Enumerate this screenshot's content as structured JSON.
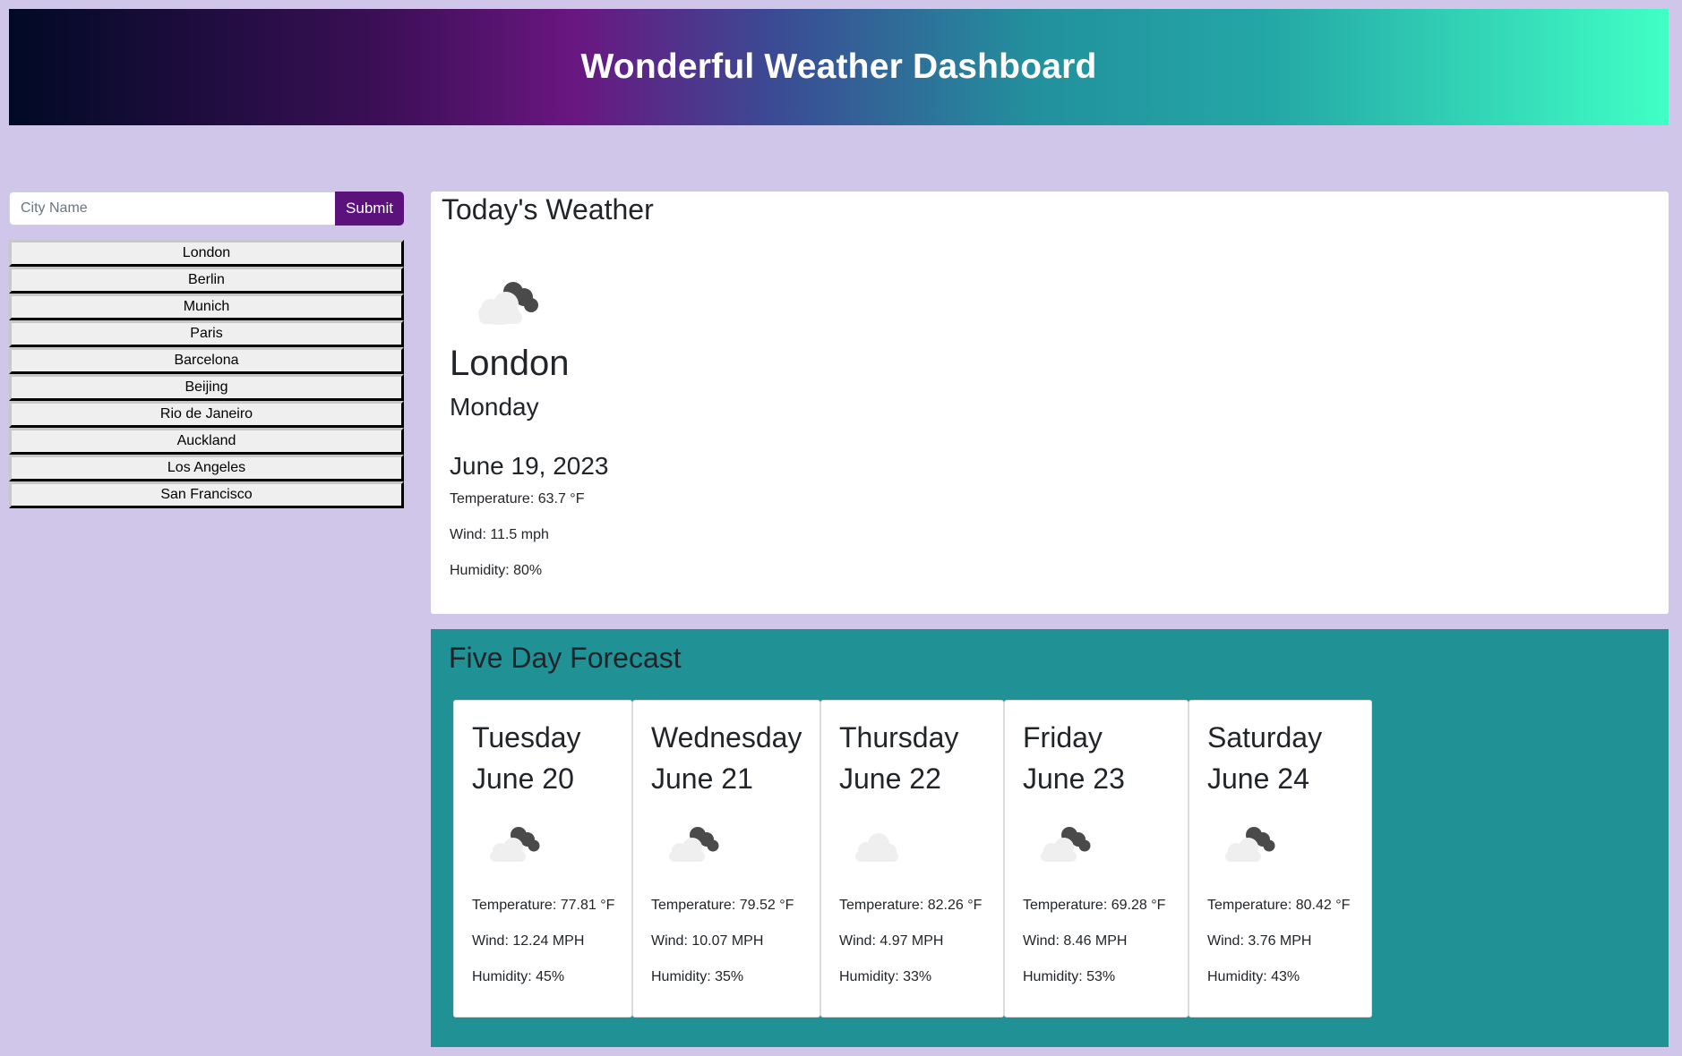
{
  "header": {
    "title": "Wonderful Weather Dashboard"
  },
  "search": {
    "placeholder": "City Name",
    "value": "",
    "submit_label": "Submit"
  },
  "history": [
    "London",
    "Berlin",
    "Munich",
    "Paris",
    "Barcelona",
    "Beijing",
    "Rio de Janeiro",
    "Auckland",
    "Los Angeles",
    "San Francisco"
  ],
  "today": {
    "heading": "Today's Weather",
    "icon": "cloudy-night-icon",
    "city": "London",
    "weekday": "Monday",
    "date": "June 19, 2023",
    "temperature": "Temperature: 63.7 °F",
    "wind": "Wind: 11.5 mph",
    "humidity": "Humidity: 80%"
  },
  "forecast": {
    "heading": "Five Day Forecast",
    "days": [
      {
        "weekday": "Tuesday",
        "date": "June 20",
        "icon": "cloudy-night-icon",
        "temperature": "Temperature: 77.81 °F",
        "wind": "Wind: 12.24 MPH",
        "humidity": "Humidity: 45%"
      },
      {
        "weekday": "Wednesday",
        "date": "June 21",
        "icon": "cloudy-night-icon",
        "temperature": "Temperature: 79.52 °F",
        "wind": "Wind: 10.07 MPH",
        "humidity": "Humidity: 35%"
      },
      {
        "weekday": "Thursday",
        "date": "June 22",
        "icon": "cloud-icon",
        "temperature": "Temperature: 82.26 °F",
        "wind": "Wind: 4.97 MPH",
        "humidity": "Humidity: 33%"
      },
      {
        "weekday": "Friday",
        "date": "June 23",
        "icon": "cloudy-night-icon",
        "temperature": "Temperature: 69.28 °F",
        "wind": "Wind: 8.46 MPH",
        "humidity": "Humidity: 53%"
      },
      {
        "weekday": "Saturday",
        "date": "June 24",
        "icon": "cloudy-night-icon",
        "temperature": "Temperature: 80.42 °F",
        "wind": "Wind: 3.76 MPH",
        "humidity": "Humidity: 43%"
      }
    ]
  },
  "colors": {
    "background": "#d0c6e9",
    "submit": "#5c127b",
    "forecast_bg": "#209194"
  }
}
